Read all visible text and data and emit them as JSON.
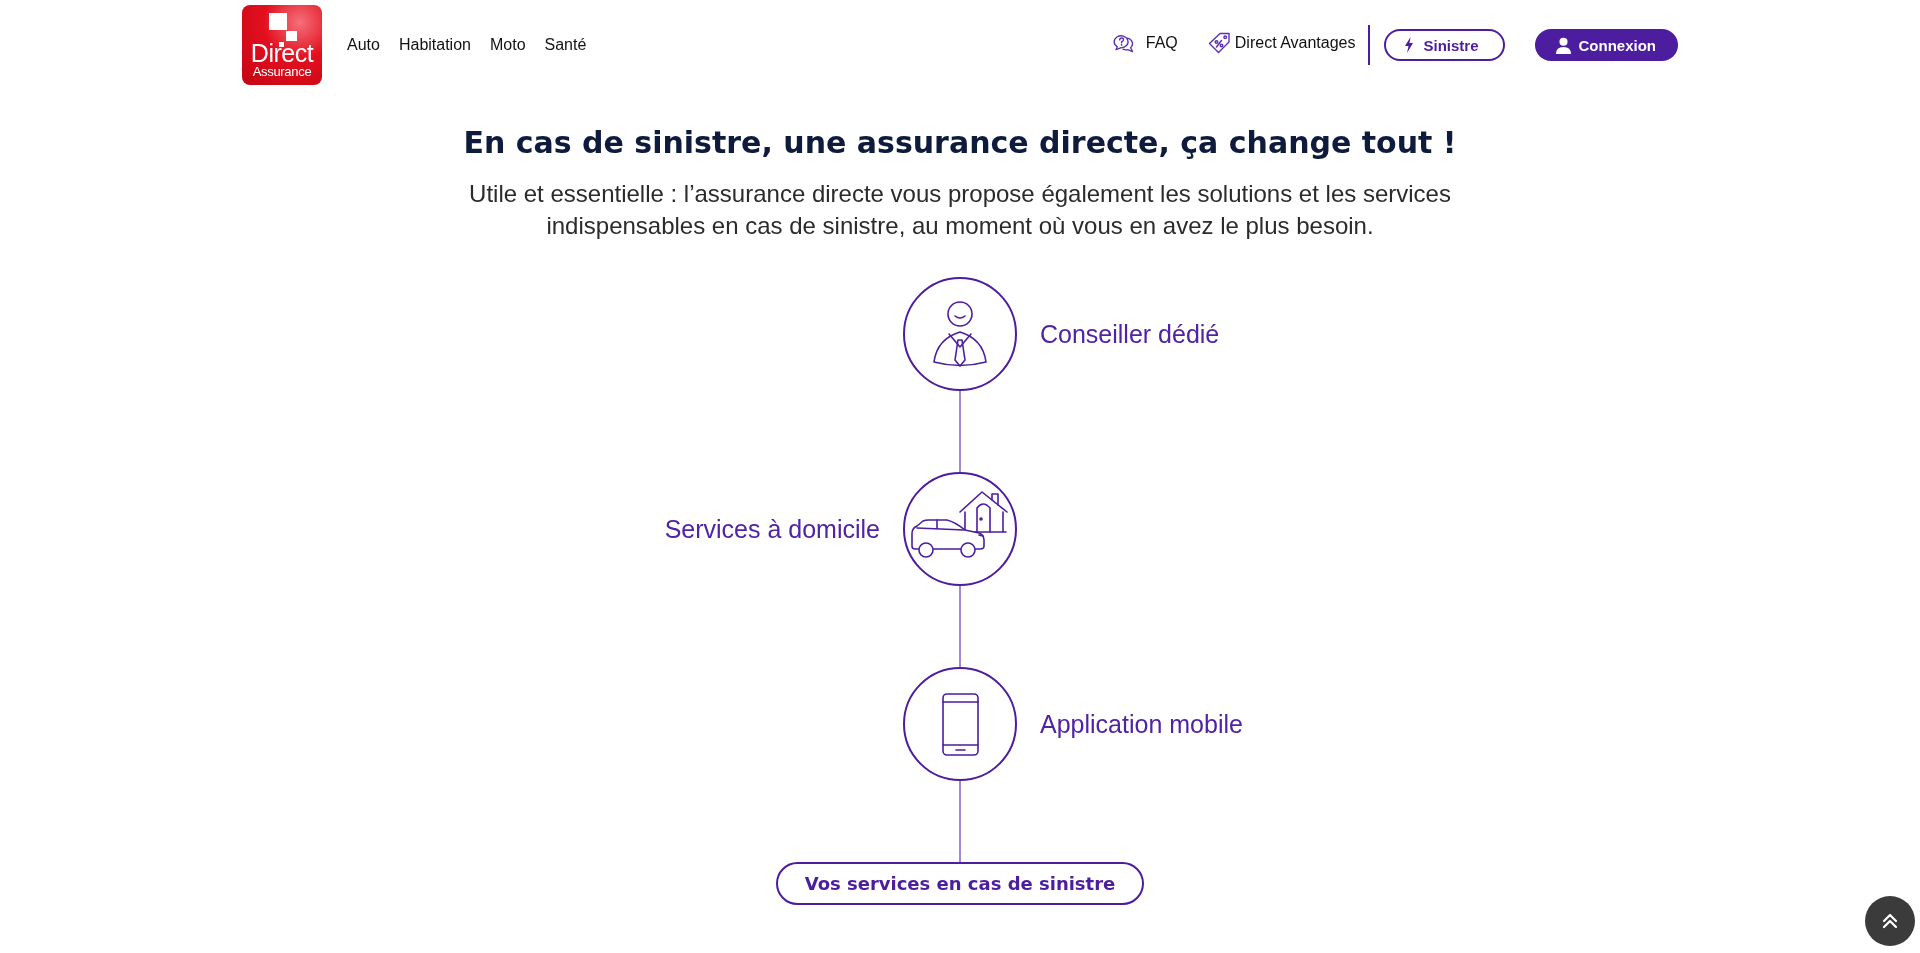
{
  "header": {
    "logo": {
      "line1": "Direct",
      "line2": "Assurance"
    },
    "nav": [
      "Auto",
      "Habitation",
      "Moto",
      "Santé"
    ],
    "links": [
      {
        "kind": "faq",
        "label": "FAQ"
      },
      {
        "kind": "offers",
        "label": "Direct Avantages"
      }
    ],
    "actions": [
      {
        "kind": "claim",
        "label": "Sinistre"
      },
      {
        "kind": "login",
        "label": "Connexion"
      }
    ]
  },
  "hero": {
    "title": "En cas de sinistre, une assurance directe, ça change tout !",
    "subtitle": "Utile et essentielle : l’assurance directe vous propose également les solutions et les services indispensables en cas de sinistre, au moment où vous en avez le plus besoin."
  },
  "steps": [
    {
      "kind": "advisor",
      "label": "Conseiller dédié"
    },
    {
      "kind": "home",
      "label": "Services à domicile"
    },
    {
      "kind": "mobile",
      "label": "Application mobile"
    }
  ],
  "cta": {
    "label": "Vos services en cas de sinistre"
  }
}
